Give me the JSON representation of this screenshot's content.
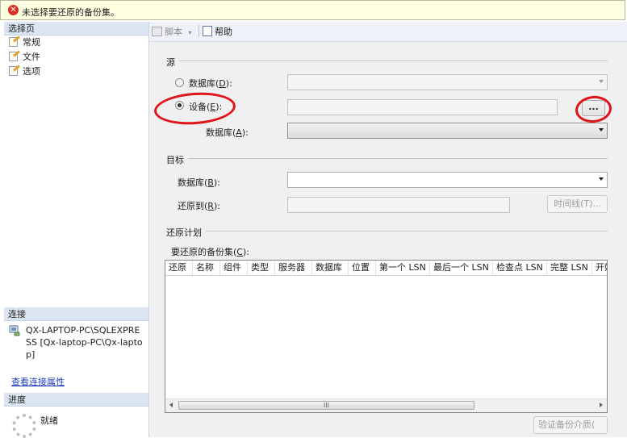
{
  "message_bar": {
    "text": "未选择要还原的备份集。"
  },
  "left": {
    "select_page_title": "选择页",
    "pages": [
      "常规",
      "文件",
      "选项"
    ],
    "connection_title": "连接",
    "server_text": "QX-LAPTOP-PC\\SQLEXPRESS [Qx-laptop-PC\\Qx-laptop]",
    "view_connection_link": "查看连接属性",
    "progress_title": "进度",
    "progress_status": "就绪"
  },
  "toolbar": {
    "script_label": "脚本",
    "help_label": "帮助"
  },
  "source": {
    "title": "源",
    "database_radio_text": "数据库(",
    "database_radio_key": "D",
    "database_radio_suffix": "):",
    "device_radio_text": "设备(",
    "device_radio_key": "E",
    "device_radio_suffix": "):",
    "selected": "device",
    "browse_label": "...",
    "database_label_text": "数据库(",
    "database_label_key": "A",
    "database_label_suffix": "):"
  },
  "target": {
    "title": "目标",
    "database_label_text": "数据库(",
    "database_label_key": "B",
    "database_label_suffix": "):",
    "restore_to_text": "还原到(",
    "restore_to_key": "R",
    "restore_to_suffix": "):",
    "timeline_button": "时间线(T)..."
  },
  "plan": {
    "title": "还原计划",
    "backup_sets_text": "要还原的备份集(",
    "backup_sets_key": "C",
    "backup_sets_suffix": "):",
    "columns": [
      "还原",
      "名称",
      "组件",
      "类型",
      "服务器",
      "数据库",
      "位置",
      "第一个 LSN",
      "最后一个 LSN",
      "检查点 LSN",
      "完整 LSN",
      "开始"
    ],
    "verify_button": "验证备份介质(",
    "scroll_grip": "III"
  },
  "colors": {
    "annotation": "#e0131b",
    "message_bg": "#ffffe1",
    "pane_header": "#dce6f3"
  }
}
